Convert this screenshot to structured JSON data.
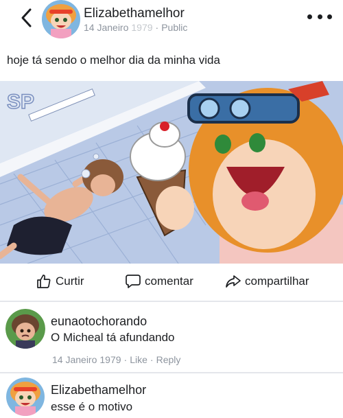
{
  "post": {
    "author": "Elizabethamelhor",
    "date": "14 Janeiro",
    "year": "1979",
    "sep": "·",
    "privacy": "Public",
    "text": "hoje tá sendo o melhor dia da minha vida",
    "image_watermark": "SP"
  },
  "actions": {
    "like": "Curtir",
    "comment": "comentar",
    "share": "compartilhar"
  },
  "comments": [
    {
      "author": "eunaotochorando",
      "text": "O Micheal tá afundando",
      "date": "14 Janeiro",
      "year": "1979",
      "dot": "·",
      "like": "Like",
      "reply": "Reply"
    },
    {
      "author": "Elizabethamelhor",
      "text": "esse é o motivo"
    }
  ],
  "icons": {
    "back": "chevron-left-icon",
    "more": "more-horizontal-icon",
    "like": "thumbs-up-icon",
    "comment": "comment-bubble-icon",
    "share": "share-arrow-icon"
  },
  "colors": {
    "text": "#1c1e21",
    "meta": "#8d949e",
    "divider": "#e4e6eb",
    "pool": "#9fb6dd",
    "hair": "#e8902a"
  }
}
